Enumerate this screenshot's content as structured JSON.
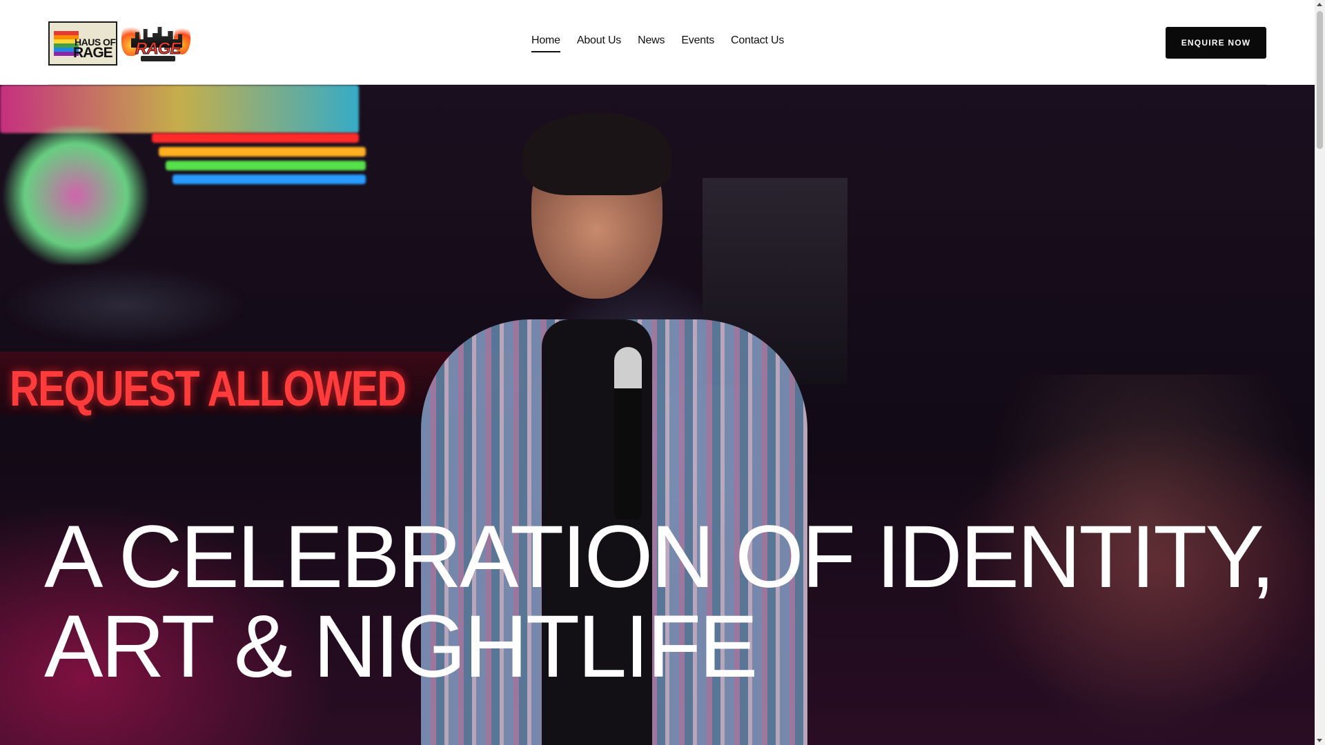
{
  "logo": {
    "haus_line1": "HAUS OF",
    "haus_line2": "RAGE",
    "rage_word": "RAGE"
  },
  "nav": {
    "items": [
      {
        "label": "Home",
        "active": true
      },
      {
        "label": "About Us",
        "active": false
      },
      {
        "label": "News",
        "active": false
      },
      {
        "label": "Events",
        "active": false
      },
      {
        "label": "Contact Us",
        "active": false
      }
    ]
  },
  "cta": {
    "label": "ENQUIRE NOW"
  },
  "hero": {
    "headline_line1": "A CELEBRATION OF IDENTITY,",
    "headline_line2": "ART & NIGHTLIFE",
    "background_sign_text": "REQUEST ALLOWED"
  },
  "colors": {
    "header_bg": "#ffffff",
    "cta_bg": "#0a0a0a",
    "cta_text": "#ffffff",
    "headline_text": "#ffffff",
    "neon_red": "#ff3b3b"
  }
}
